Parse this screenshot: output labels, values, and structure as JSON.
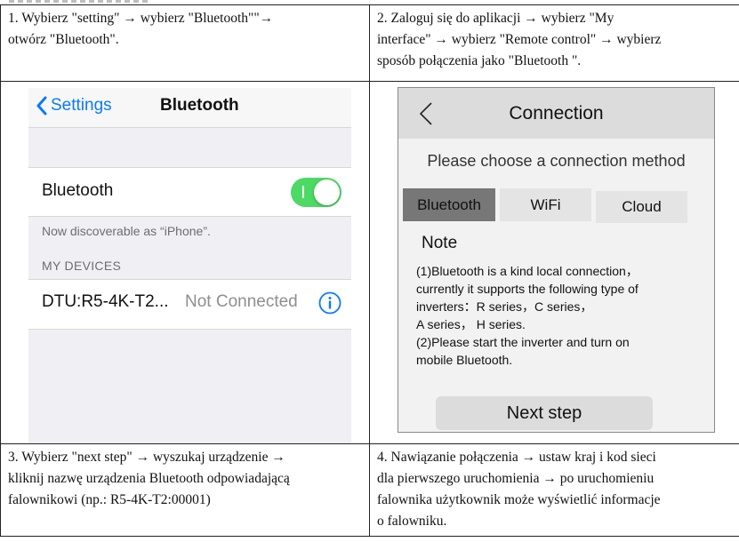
{
  "steps": {
    "step1": {
      "lines": [
        "1. Wybierz \"setting\" → wybierz \"Bluetooth\"\"→",
        "otwórz \"Bluetooth\"."
      ]
    },
    "step2": {
      "lines": [
        "2. Zaloguj się do aplikacji → wybierz \"My",
        "interface\" → wybierz \"Remote control\" → wybierz",
        "sposób połączenia jako \"Bluetooth \"."
      ]
    },
    "step3": {
      "lines": [
        "3. Wybierz \"next step\" → wyszukaj urządzenie →",
        "kliknij nazwę urządzenia Bluetooth odpowiadającą",
        "falownikowi (np.: R5-4K-T2:00001)"
      ]
    },
    "step4": {
      "lines": [
        "4. Nawiązanie połączenia → ustaw kraj i kod sieci",
        "dla pierwszego uruchomienia → po uruchomieniu",
        "falownika użytkownik może wyświetlić informacje",
        "o falowniku."
      ]
    }
  },
  "ios": {
    "back_label": "Settings",
    "title": "Bluetooth",
    "bluetooth_label": "Bluetooth",
    "bluetooth_on": true,
    "discoverable_note": "Now discoverable as “iPhone”.",
    "devices_header": "MY DEVICES",
    "device_name": "DTU:R5-4K-T2...",
    "device_status": "Not Connected",
    "accent": "#0a7aff",
    "toggle_color": "#4cd964",
    "icons": {
      "back": "chevron-left-icon",
      "info": "info-icon"
    }
  },
  "app": {
    "title": "Connection",
    "prompt": "Please choose a connection method",
    "tabs": [
      "Bluetooth",
      "WiFi",
      "Cloud"
    ],
    "selected_tab": "Bluetooth",
    "note_title": "Note",
    "note_lines": [
      "(1)Bluetooth is a kind local connection，",
      "currently it supports the following type of",
      "inverters：R series，C series，",
      "A series， H series.",
      "(2)Please start the inverter and turn on",
      "mobile Bluetooth."
    ],
    "next_button": "Next step",
    "icons": {
      "back": "chevron-left-icon"
    }
  }
}
